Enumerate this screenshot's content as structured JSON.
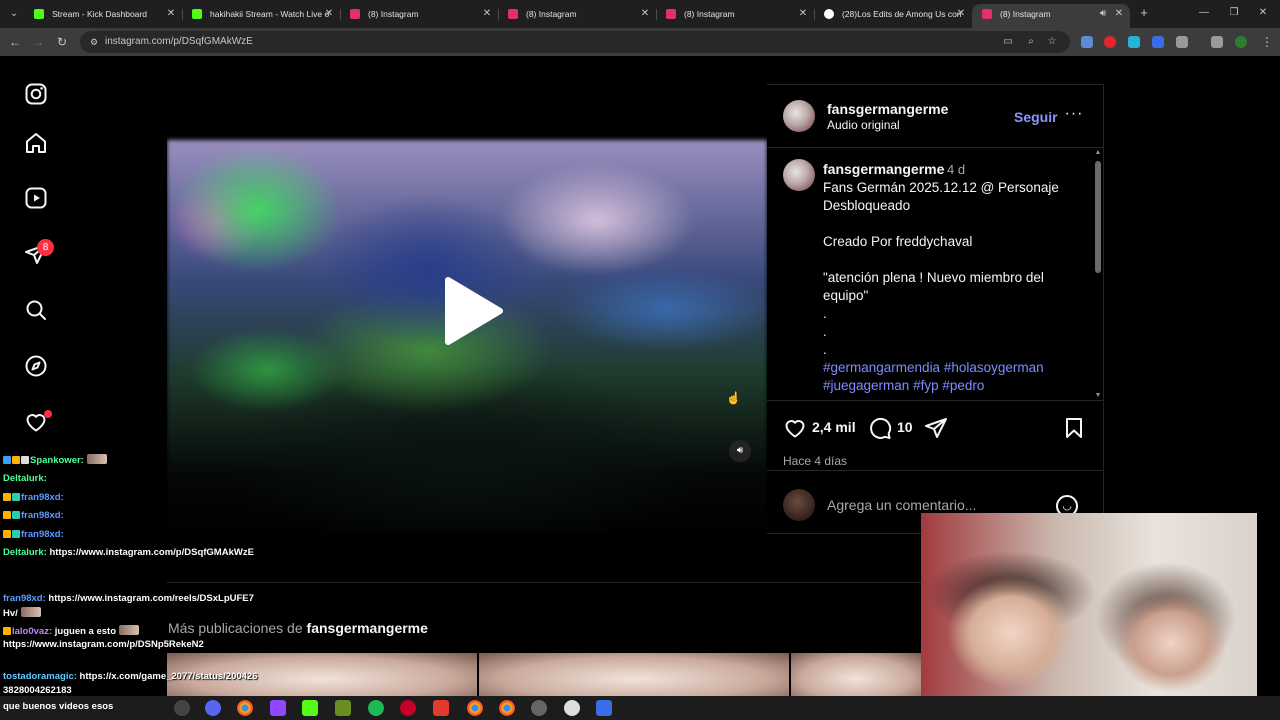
{
  "browser": {
    "tabs": [
      {
        "title": "Stream - Kick Dashboard",
        "favicon_color": "#53fc18"
      },
      {
        "title": "hakihakii Stream - Watch Live o",
        "favicon_color": "#53fc18"
      },
      {
        "title": "(8) Instagram",
        "favicon_color": "#e1306c"
      },
      {
        "title": "(8) Instagram",
        "favicon_color": "#e1306c"
      },
      {
        "title": "(8) Instagram",
        "favicon_color": "#e1306c"
      },
      {
        "title": "(28)Los Edits de Among Us con",
        "favicon_color": "#ffffff"
      },
      {
        "title": "(8) Instagram",
        "favicon_color": "#e1306c"
      }
    ],
    "active_tab_index": 6,
    "url": "instagram.com/p/DSqfGMAkWzE"
  },
  "instagram": {
    "nav_icons": [
      "instagram-logo-icon",
      "home-icon",
      "reels-icon",
      "messages-icon",
      "search-icon",
      "explore-icon",
      "notifications-heart-icon"
    ],
    "messages_badge": "8",
    "post": {
      "username": "fansgermangerme",
      "audio": "Audio original",
      "follow_label": "Seguir",
      "more_label": "···",
      "caption": {
        "username": "fansgermangerme",
        "time": "4 d",
        "lines": [
          "Fans Germán 2025.12.12 @ Personaje Desbloqueado",
          "",
          "Creado Por freddychaval",
          "",
          "\"atención plena ! Nuevo miembro del equipo\"",
          ".",
          ".",
          "."
        ],
        "hashtags": "#germangarmendia #holasoygerman #juegagerman #fyp #pedro"
      },
      "likes": "2,4 mil",
      "comments": "10",
      "posted_ago": "Hace 4 días",
      "comment_placeholder": "Agrega un comentario..."
    },
    "more_publications": {
      "prefix": "Más publicaciones de",
      "username": "fansgermangerme"
    }
  },
  "stream_chat": [
    {
      "user": "Spankower:",
      "text": "",
      "user_color": "#4cff9a"
    },
    {
      "user": "Deltalurk:",
      "text": "",
      "user_color": "#4cff9a"
    },
    {
      "user": "fran98xd:",
      "text": "",
      "user_color": "#5a9cff"
    },
    {
      "user": "fran98xd:",
      "text": "",
      "user_color": "#5a9cff"
    },
    {
      "user": "fran98xd:",
      "text": "",
      "user_color": "#5a9cff"
    },
    {
      "user": "Deltalurk:",
      "text": "https://www.instagram.com/p/DSqfGMAkWzE",
      "user_color": "#4cff9a"
    },
    {
      "user": "fran98xd:",
      "text": "https://www.instagram.com/reels/DSxLpUFE7",
      "user_color": "#5a9cff"
    },
    {
      "user": "Hv/",
      "text": "",
      "user_color": "#ffffff"
    },
    {
      "user": "lalo0vaz:",
      "text": "juguen a esto",
      "user_color": "#b88aff"
    },
    {
      "user": "",
      "text": "https://www.instagram.com/p/DSNp5RekeN2",
      "user_color": "#ffffff"
    },
    {
      "user": "tostadoramagic:",
      "text": "https://x.com/game_2077/status/200426",
      "user_color": "#62c9ff"
    },
    {
      "user": "",
      "text": "3828004262183",
      "user_color": "#ffffff"
    }
  ],
  "taskbar_chat": "que buenos videos esos"
}
